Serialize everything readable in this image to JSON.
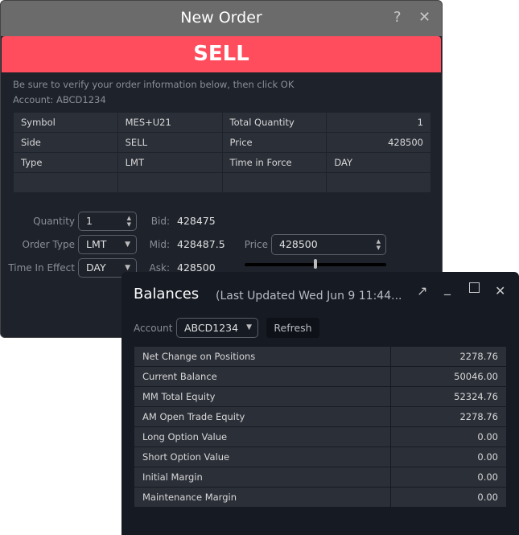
{
  "order": {
    "title": "New Order",
    "help_icon": "question-icon",
    "close_icon": "close-icon",
    "side_banner": "SELL",
    "side_color": "#ff4d5e",
    "note": "Be sure to verify your order information below, then click OK",
    "account_line": "Account: ABCD1234",
    "summary": [
      [
        "Symbol",
        "MES+U21",
        "Total Quantity",
        "1"
      ],
      [
        "Side",
        "SELL",
        "Price",
        "428500"
      ],
      [
        "Type",
        "LMT",
        "Time in Force",
        "DAY"
      ],
      [
        "",
        "",
        "",
        ""
      ]
    ],
    "form": {
      "quantity_label": "Quantity",
      "quantity": "1",
      "order_type_label": "Order Type",
      "order_type": "LMT",
      "tif_label": "Time In Effect",
      "tif": "DAY",
      "bid_label": "Bid:",
      "bid": "428475",
      "mid_label": "Mid:",
      "mid": "428487.5",
      "ask_label": "Ask:",
      "ask": "428500",
      "price_label": "Price",
      "price": "428500",
      "slider_value": 50
    }
  },
  "balances": {
    "title": "Balances",
    "subtitle": "(Last Updated Wed Jun 9 11:44...",
    "account_label": "Account",
    "account": "ABCD1234",
    "refresh": "Refresh",
    "rows": [
      [
        "Net Change on Positions",
        "2278.76"
      ],
      [
        "Current Balance",
        "50046.00"
      ],
      [
        "MM Total Equity",
        "52324.76"
      ],
      [
        "AM Open Trade Equity",
        "2278.76"
      ],
      [
        "Long Option Value",
        "0.00"
      ],
      [
        "Short Option Value",
        "0.00"
      ],
      [
        "Initial Margin",
        "0.00"
      ],
      [
        "Maintenance Margin",
        "0.00"
      ]
    ]
  }
}
